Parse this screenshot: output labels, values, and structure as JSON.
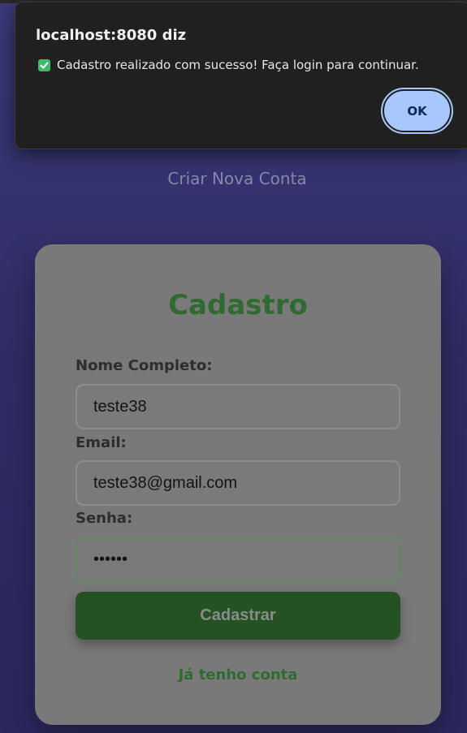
{
  "dialog": {
    "title": "localhost:8080 diz",
    "message": "Cadastro realizado com sucesso! Faça login para continuar.",
    "message_icon": "check-box-icon",
    "ok_label": "OK"
  },
  "page": {
    "subtitle": "Criar Nova Conta"
  },
  "form": {
    "title": "Cadastro",
    "name_label": "Nome Completo:",
    "name_value": "teste38",
    "email_label": "Email:",
    "email_value": "teste38@gmail.com",
    "password_label": "Senha:",
    "password_value": "••••••",
    "submit_label": "Cadastrar",
    "login_link": "Já tenho conta"
  },
  "colors": {
    "accent_green": "#2f6b31",
    "button_green": "#245225",
    "ok_button": "#a8c7fa",
    "dialog_bg": "#202020"
  }
}
